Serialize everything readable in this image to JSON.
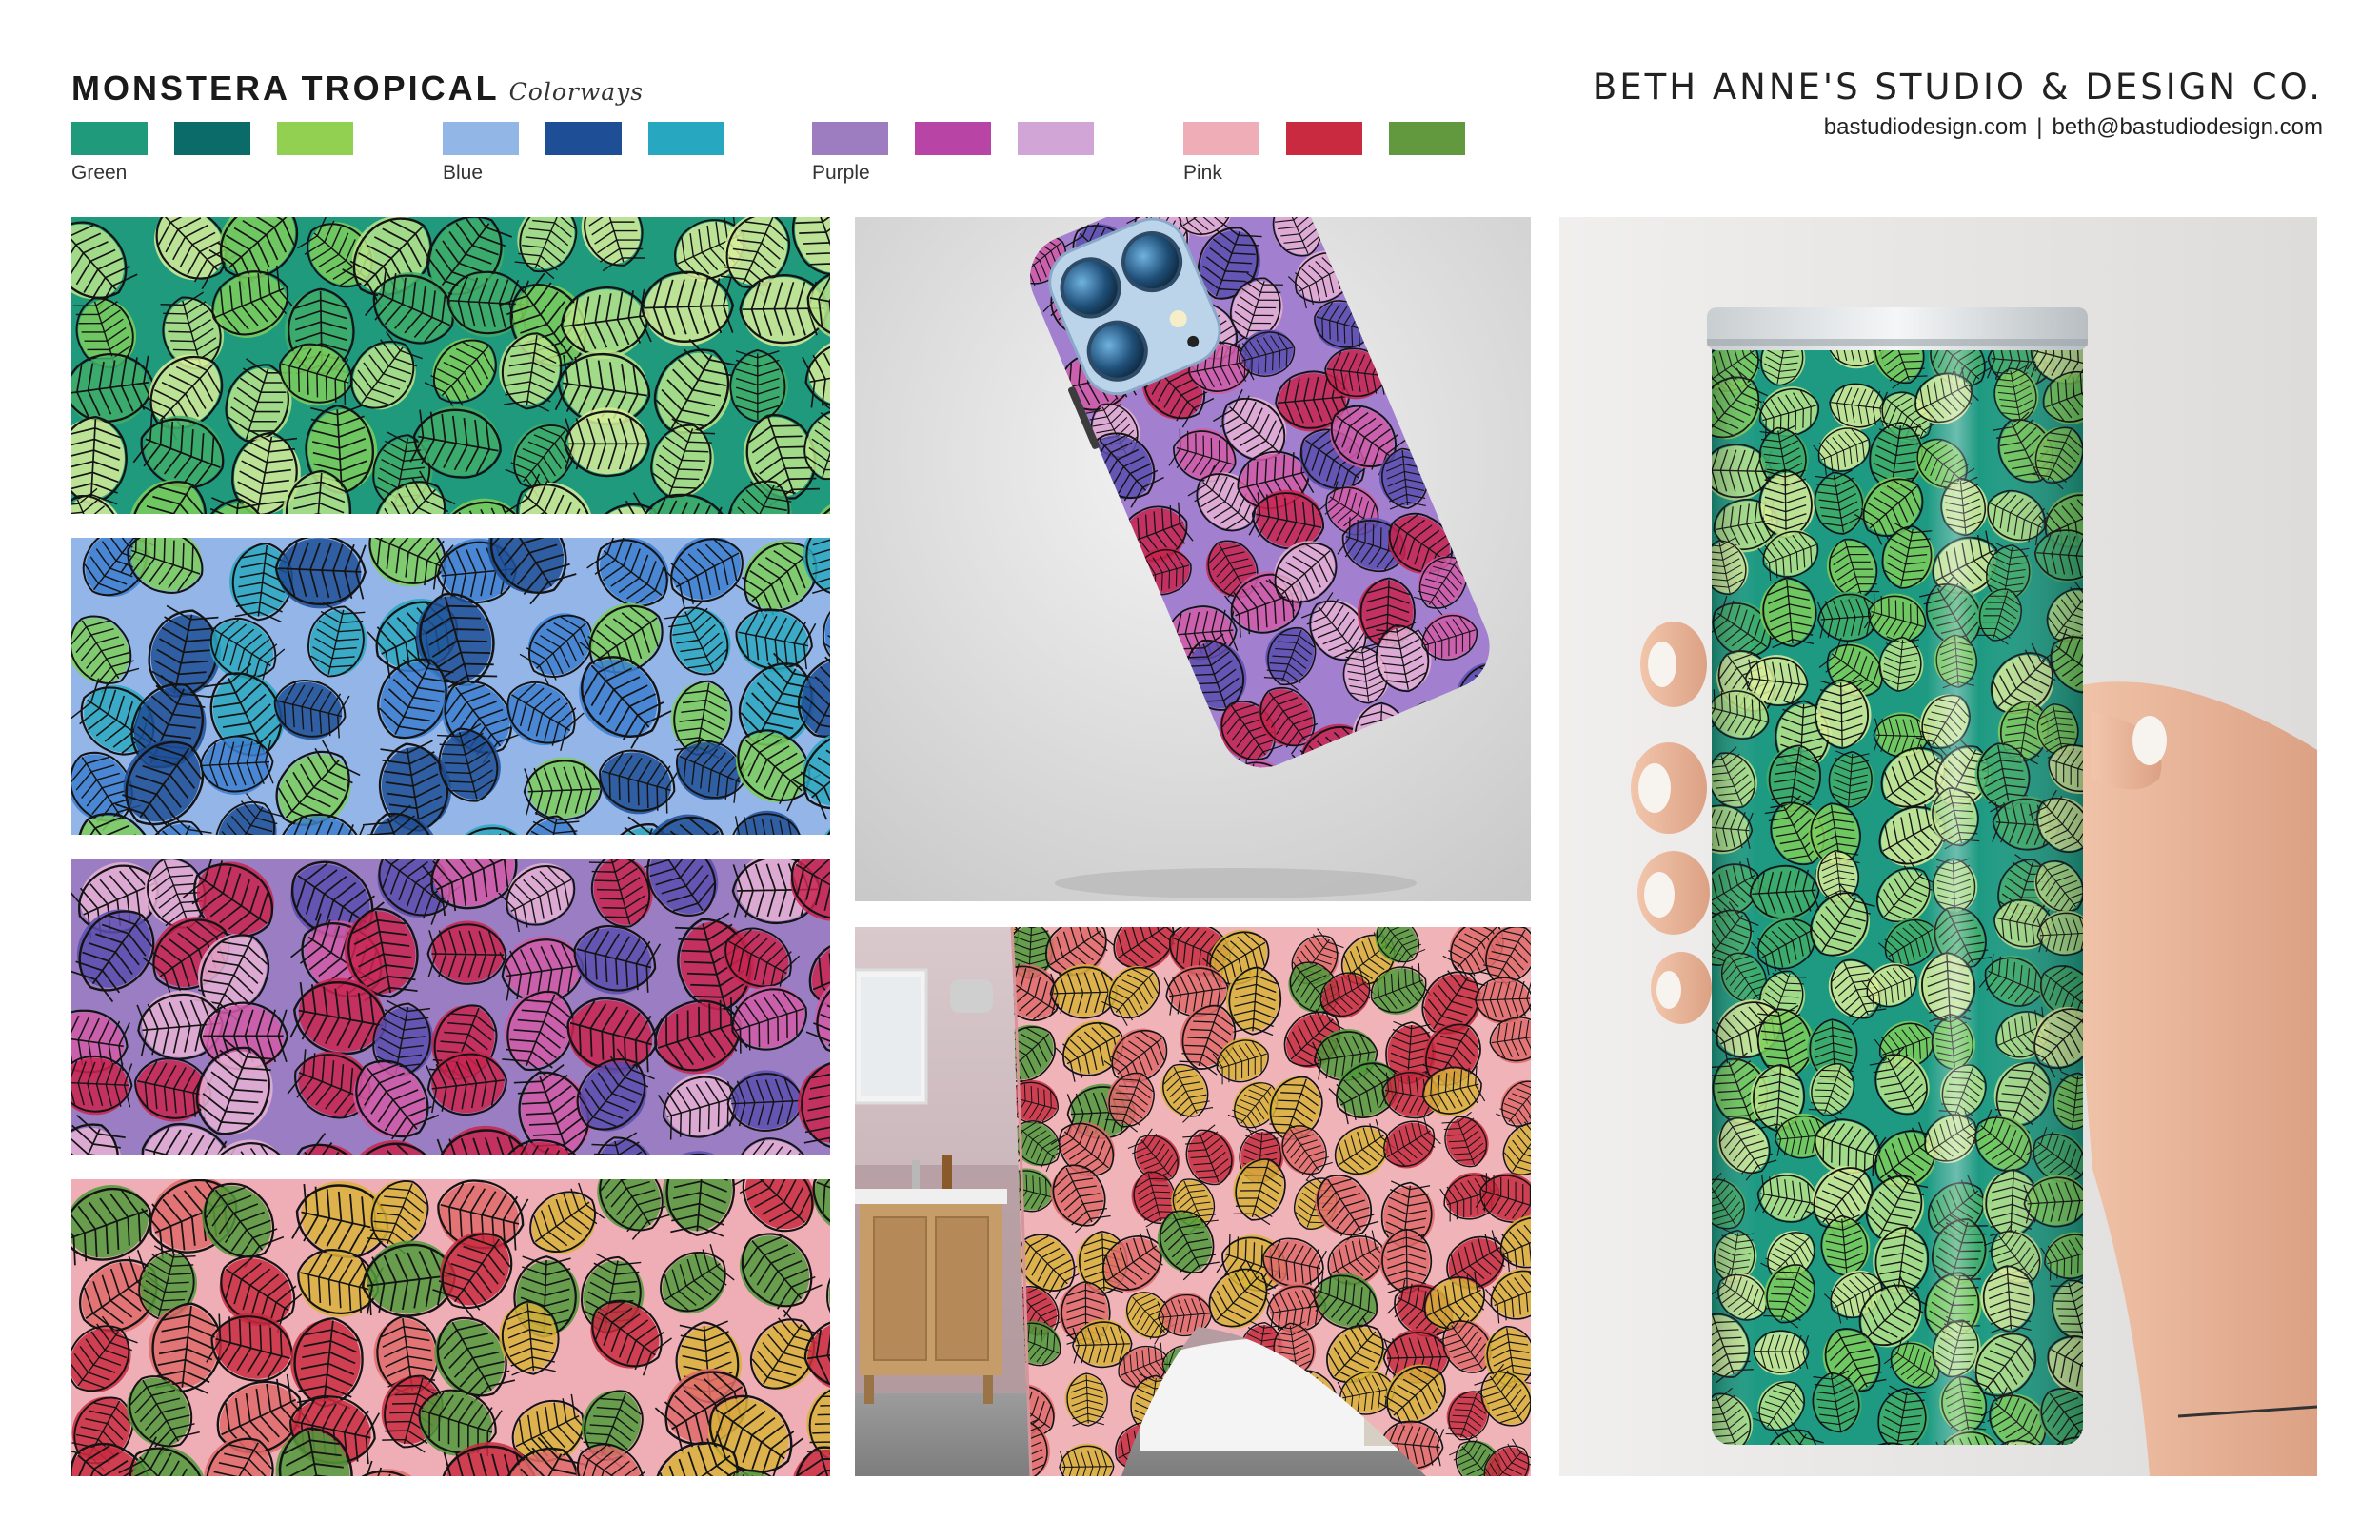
{
  "header": {
    "title": "MONSTERA TROPICAL",
    "subtitle": "Colorways",
    "brand": "BETH ANNE'S STUDIO & DESIGN CO.",
    "website": "bastudiodesign.com",
    "separator": "|",
    "email": "beth@bastudiodesign.com"
  },
  "colorways": [
    {
      "label": "Green",
      "colors": [
        "#1f9b7c",
        "#0b6b68",
        "#92d051"
      ]
    },
    {
      "label": "Blue",
      "colors": [
        "#92b6e6",
        "#1e4f96",
        "#28a8c0"
      ]
    },
    {
      "label": "Purple",
      "colors": [
        "#9e7cc0",
        "#b845a6",
        "#d1a6d6"
      ]
    },
    {
      "label": "Pink",
      "colors": [
        "#efadb7",
        "#c92a3f",
        "#62993f"
      ]
    }
  ],
  "patterns": [
    {
      "name": "green",
      "bg": "#1f9a7d",
      "leaves": [
        "#7ccf5a",
        "#b8e58a",
        "#3fae6a",
        "#d8ef9a"
      ]
    },
    {
      "name": "blue",
      "bg": "#93b5e8",
      "leaves": [
        "#1e4f96",
        "#2aa8bf",
        "#7ccf5a",
        "#3c7fd0"
      ]
    },
    {
      "name": "purple",
      "bg": "#9a7dc2",
      "leaves": [
        "#c9234f",
        "#d25aa8",
        "#e7b0d6",
        "#5b4db0"
      ]
    },
    {
      "name": "pink",
      "bg": "#efaeb6",
      "leaves": [
        "#c92a3f",
        "#4f9a3b",
        "#d9b23a",
        "#e06a6a"
      ]
    }
  ]
}
